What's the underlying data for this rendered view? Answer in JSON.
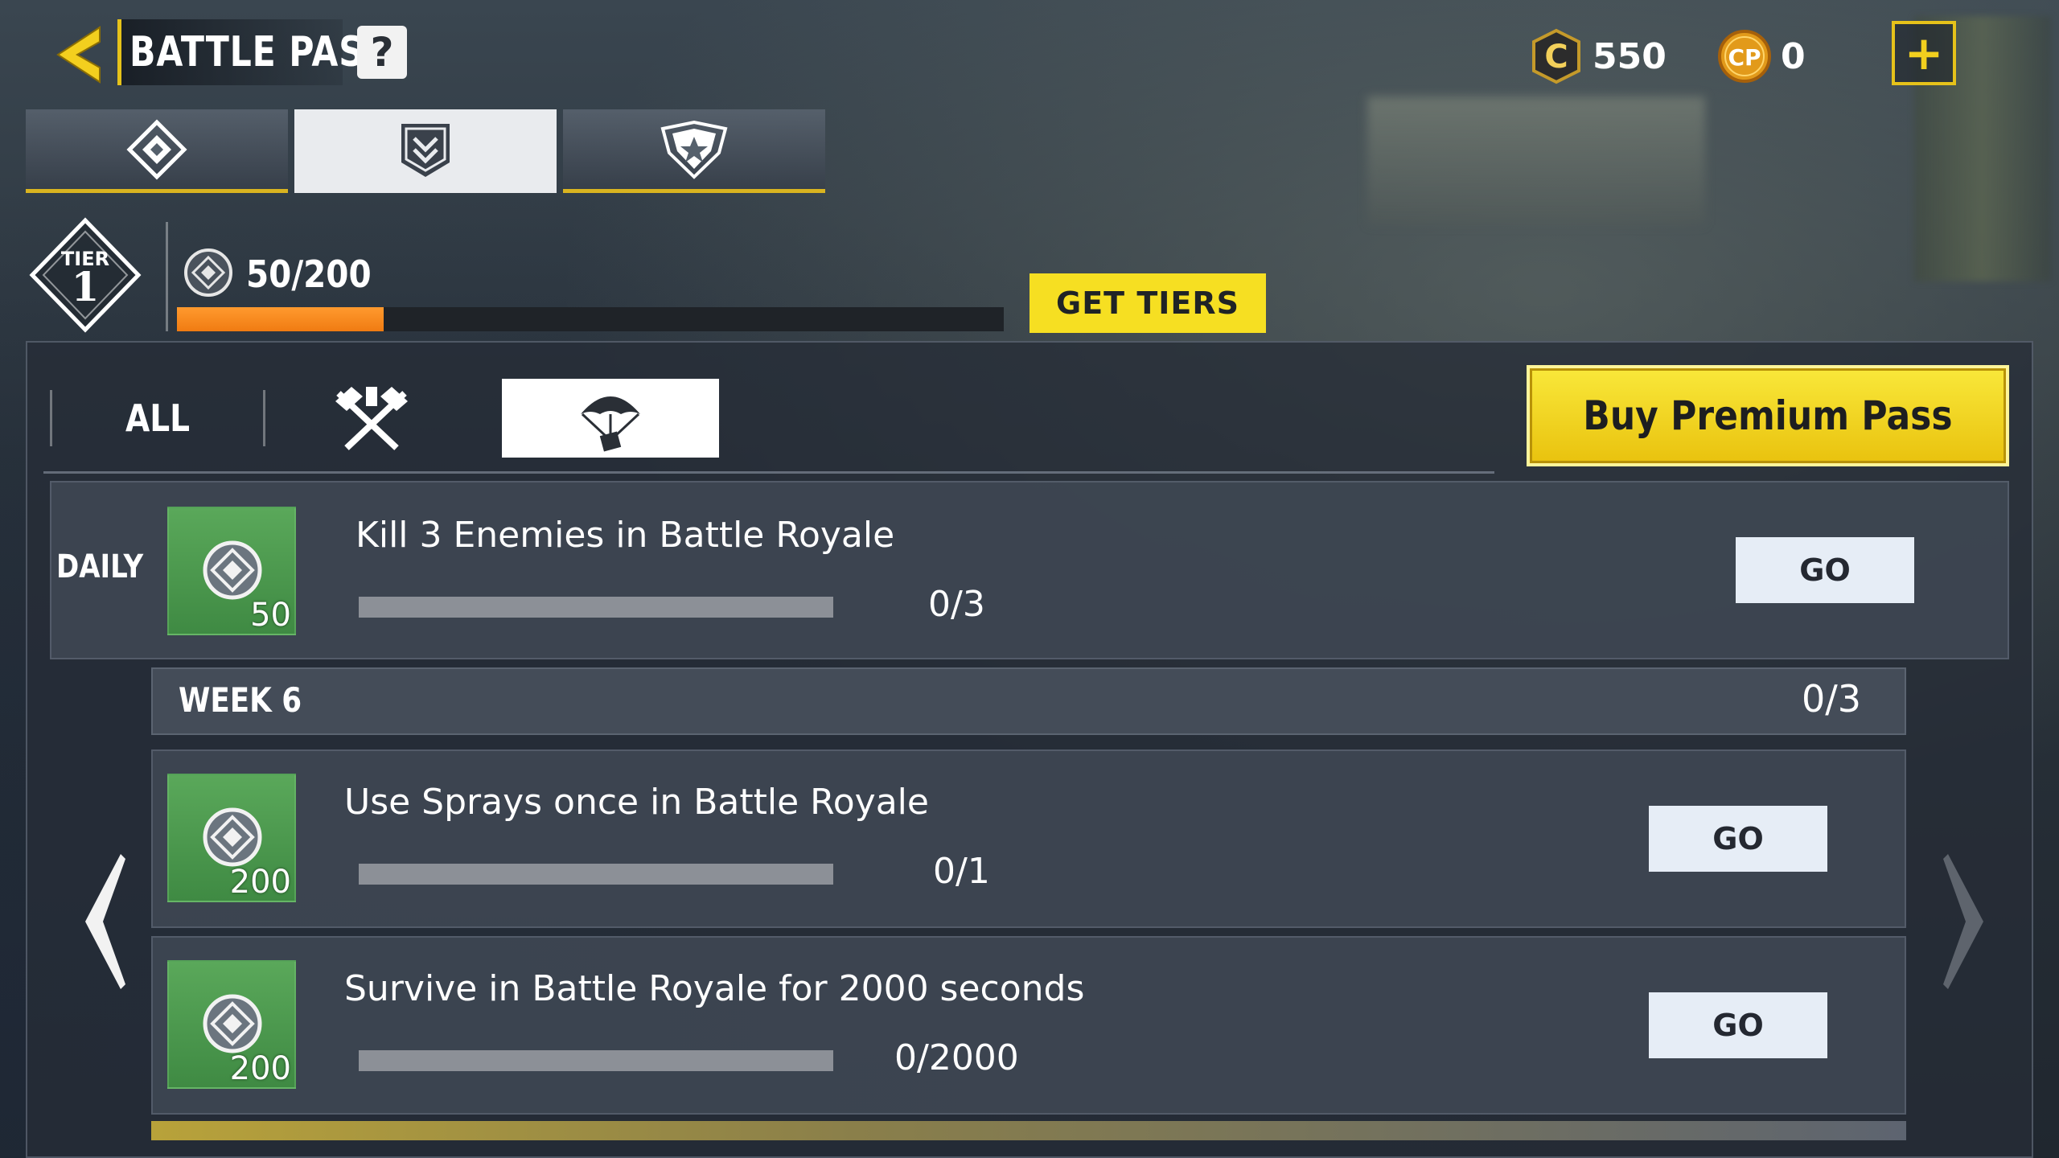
{
  "header": {
    "title": "BATTLE PASS",
    "help_label": "?",
    "icons": {
      "back": "back-arrow-icon",
      "help": "help-icon",
      "add": "plus-icon"
    }
  },
  "currency": [
    {
      "name": "cod-credits",
      "icon": "c-coin-icon",
      "amount": "550"
    },
    {
      "name": "cod-points",
      "icon": "cp-coin-icon",
      "amount": "0"
    }
  ],
  "plus_label": "+",
  "top_tabs": [
    {
      "name": "tab-overview",
      "icon": "diamond-icon",
      "active": false
    },
    {
      "name": "tab-tasks",
      "icon": "banner-icon",
      "active": true
    },
    {
      "name": "tab-rewards",
      "icon": "shield-star-icon",
      "active": false
    }
  ],
  "tier": {
    "label": "TIER",
    "value": "1",
    "xp_text": "50/200",
    "progress": 0.25,
    "get_tiers_label": "GET TIERS"
  },
  "filters": {
    "all_label": "ALL",
    "mp_icon": "crossed-weapons-icon",
    "br_icon": "parachute-icon",
    "selected": "battle-royale"
  },
  "premium_label": "Buy Premium Pass",
  "daily": {
    "label": "DAILY",
    "task": {
      "title": "Kill 3 Enemies in Battle Royale",
      "count": "0/3",
      "reward": "50",
      "progress": 0,
      "go_label": "GO"
    }
  },
  "week": {
    "label": "WEEK 6",
    "count": "0/3",
    "tasks": [
      {
        "title": "Use Sprays once in Battle Royale",
        "count": "0/1",
        "reward": "200",
        "progress": 0,
        "go_label": "GO"
      },
      {
        "title": "Survive in Battle Royale for 2000 seconds",
        "count": "0/2000",
        "reward": "200",
        "progress": 0,
        "go_label": "GO"
      }
    ]
  },
  "colors": {
    "accent": "#f6df22",
    "xp_fill": "#f07b12",
    "reward_green": "#4a9a4e",
    "go_bg": "#e6edf6"
  }
}
